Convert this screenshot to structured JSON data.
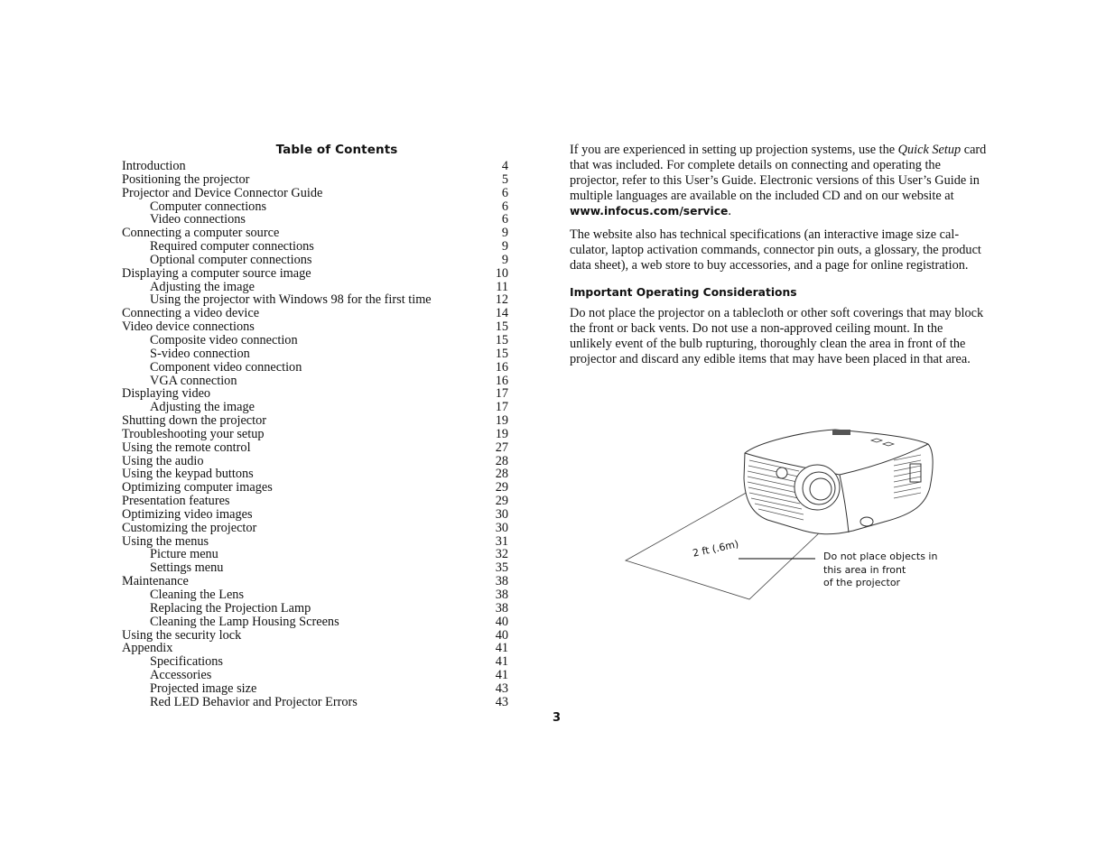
{
  "toc": {
    "title": "Table of Contents",
    "entries": [
      {
        "label": "Introduction",
        "page": "4",
        "level": 1
      },
      {
        "label": "Positioning the projector",
        "page": "5",
        "level": 1
      },
      {
        "label": "Projector and Device Connector Guide",
        "page": "6",
        "level": 1
      },
      {
        "label": "Computer connections",
        "page": "6",
        "level": 2
      },
      {
        "label": "Video connections",
        "page": "6",
        "level": 2
      },
      {
        "label": "Connecting a computer source",
        "page": "9",
        "level": 1
      },
      {
        "label": "Required computer connections",
        "page": "9",
        "level": 2
      },
      {
        "label": "Optional computer connections",
        "page": "9",
        "level": 2
      },
      {
        "label": "Displaying a computer source image",
        "page": "10",
        "level": 1
      },
      {
        "label": "Adjusting the image",
        "page": "11",
        "level": 2
      },
      {
        "label": "Using the projector with Windows 98 for the first time",
        "page": "12",
        "level": 2
      },
      {
        "label": "Connecting a video device",
        "page": "14",
        "level": 1
      },
      {
        "label": "Video device connections",
        "page": "15",
        "level": 1
      },
      {
        "label": "Composite video connection",
        "page": "15",
        "level": 2
      },
      {
        "label": "S-video connection",
        "page": "15",
        "level": 2
      },
      {
        "label": "Component video connection",
        "page": "16",
        "level": 2
      },
      {
        "label": "VGA connection",
        "page": "16",
        "level": 2
      },
      {
        "label": "Displaying video",
        "page": "17",
        "level": 1
      },
      {
        "label": "Adjusting the image",
        "page": "17",
        "level": 2
      },
      {
        "label": "Shutting down the projector",
        "page": "19",
        "level": 1
      },
      {
        "label": "Troubleshooting your setup",
        "page": "19",
        "level": 1
      },
      {
        "label": "Using the remote control",
        "page": "27",
        "level": 1
      },
      {
        "label": "Using the audio",
        "page": "28",
        "level": 1
      },
      {
        "label": "Using the keypad buttons",
        "page": "28",
        "level": 1
      },
      {
        "label": "Optimizing computer images",
        "page": "29",
        "level": 1
      },
      {
        "label": "Presentation features",
        "page": "29",
        "level": 1
      },
      {
        "label": "Optimizing video images",
        "page": "30",
        "level": 1
      },
      {
        "label": "Customizing the projector",
        "page": "30",
        "level": 1
      },
      {
        "label": "Using the menus",
        "page": "31",
        "level": 1
      },
      {
        "label": "Picture menu",
        "page": "32",
        "level": 2
      },
      {
        "label": "Settings menu",
        "page": "35",
        "level": 2
      },
      {
        "label": "Maintenance",
        "page": "38",
        "level": 1
      },
      {
        "label": "Cleaning the Lens",
        "page": "38",
        "level": 2
      },
      {
        "label": "Replacing the Projection Lamp",
        "page": "38",
        "level": 2
      },
      {
        "label": "Cleaning the Lamp Housing Screens",
        "page": "40",
        "level": 2
      },
      {
        "label": "Using the security lock",
        "page": "40",
        "level": 1
      },
      {
        "label": "Appendix",
        "page": "41",
        "level": 1
      },
      {
        "label": "Specifications",
        "page": "41",
        "level": 2
      },
      {
        "label": "Accessories",
        "page": "41",
        "level": 2
      },
      {
        "label": "Projected image size",
        "page": "43",
        "level": 2
      },
      {
        "label": "Red LED Behavior and Projector Errors",
        "page": "43",
        "level": 2
      }
    ]
  },
  "intro": {
    "p1_before": "If you are experienced in setting up projection systems, use the ",
    "p1_italic": "Quick Setup",
    "p1_middle": " card that was included. For complete details on connecting and operating the projector, refer to this User’s Guide. Electronic versions of this User’s Guide in multiple languages are available on the included CD and on our website at ",
    "p1_url": "www.infocus.com/service",
    "p1_after": ".",
    "p2": "The website also has technical specifications (an interactive image size cal-culator, laptop activation commands, connector pin outs, a glossary, the product data sheet), a web store to buy accessories, and a page for online registration."
  },
  "considerations": {
    "heading": "Important Operating Considerations",
    "body": "Do not place the projector on a tablecloth or other soft coverings that may block the front or back vents. Do not use a non-approved ceiling mount. In the unlikely event of the bulb rupturing, thoroughly clean the area in front of the projector and discard any edible items that may have been placed in that area."
  },
  "figure": {
    "subject": "projector-clearance-illustration",
    "distance_label": "2 ft (.6m)",
    "warning_lines": [
      "Do not place objects in",
      "this area in front",
      "of the projector"
    ]
  },
  "page_number": "3"
}
